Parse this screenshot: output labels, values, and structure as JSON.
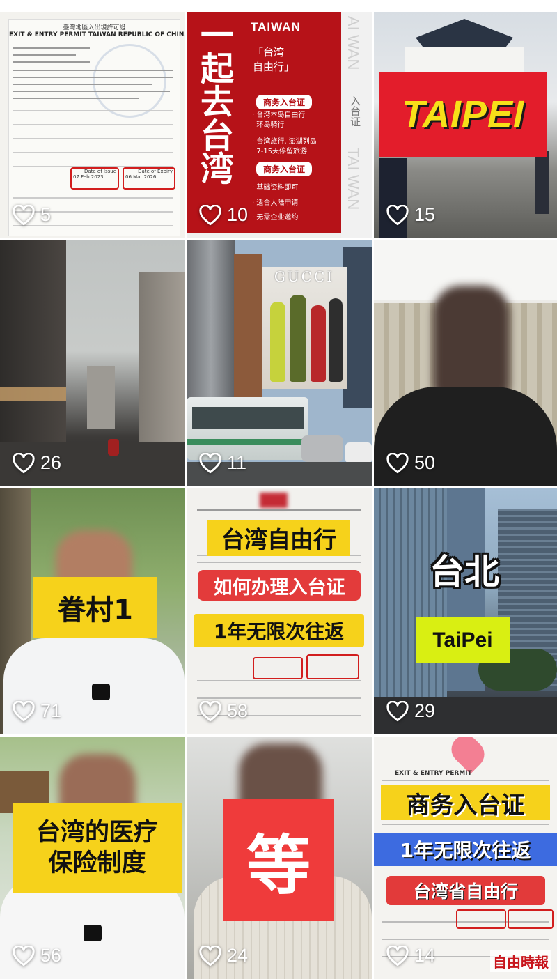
{
  "tiles": [
    {
      "likes": "5",
      "doc_title_cn": "臺灣地區入出境許可證",
      "doc_title_en": "EXIT & ENTRY PERMIT TAIWAN REPUBLIC OF CHINA",
      "date_issue_label": "Date of Issue",
      "date_issue": "07 Feb 2023",
      "date_expiry_label": "Date of Expiry",
      "date_expiry": "06 Mar 2026"
    },
    {
      "likes": "10",
      "vertical_title": "一起去台湾",
      "brand": "TAIWAN",
      "subtitle": "「台湾\n自由行」",
      "section1": "商务入台证",
      "line1": "· 台湾本岛自由行\n  环岛骑行",
      "line2": "· 台湾旅行, 澎湖列岛\n  7-15天停留旅游",
      "section2": "商务入台证",
      "line3": "· 基础资料即可",
      "line4": "· 适合大陆申请",
      "line5": "· 无需企业邀约",
      "side_text_1": "AI WAN",
      "side_text_2": "入台证",
      "side_text_3": "TAI WAN"
    },
    {
      "likes": "15",
      "banner": "TAIPEI"
    },
    {
      "likes": "26"
    },
    {
      "likes": "11",
      "billboard": "GUCCI"
    },
    {
      "likes": "50"
    },
    {
      "likes": "71",
      "caption": "眷村1"
    },
    {
      "likes": "58",
      "headline": "台湾自由行",
      "red_label": "如何办理入台证",
      "yellow_label": "1年无限次往返"
    },
    {
      "likes": "29",
      "title_cn": "台北",
      "title_en": "TaiPei"
    },
    {
      "likes": "56",
      "caption": "台湾的医疗\n保险制度"
    },
    {
      "likes": "24",
      "caption": "等"
    },
    {
      "likes": "14",
      "doc_title_en": "EXIT & ENTRY PERMIT",
      "line1": "商务入台证",
      "line2": "1年无限次往返",
      "line3": "台湾省自由行"
    }
  ],
  "watermark": "自由時報",
  "colors": {
    "heart": "#ffffff",
    "red": "#c9161d",
    "yellow": "#f6d21b",
    "lime": "#d9ef12"
  },
  "icons": {
    "like": "heart-outline-icon"
  }
}
